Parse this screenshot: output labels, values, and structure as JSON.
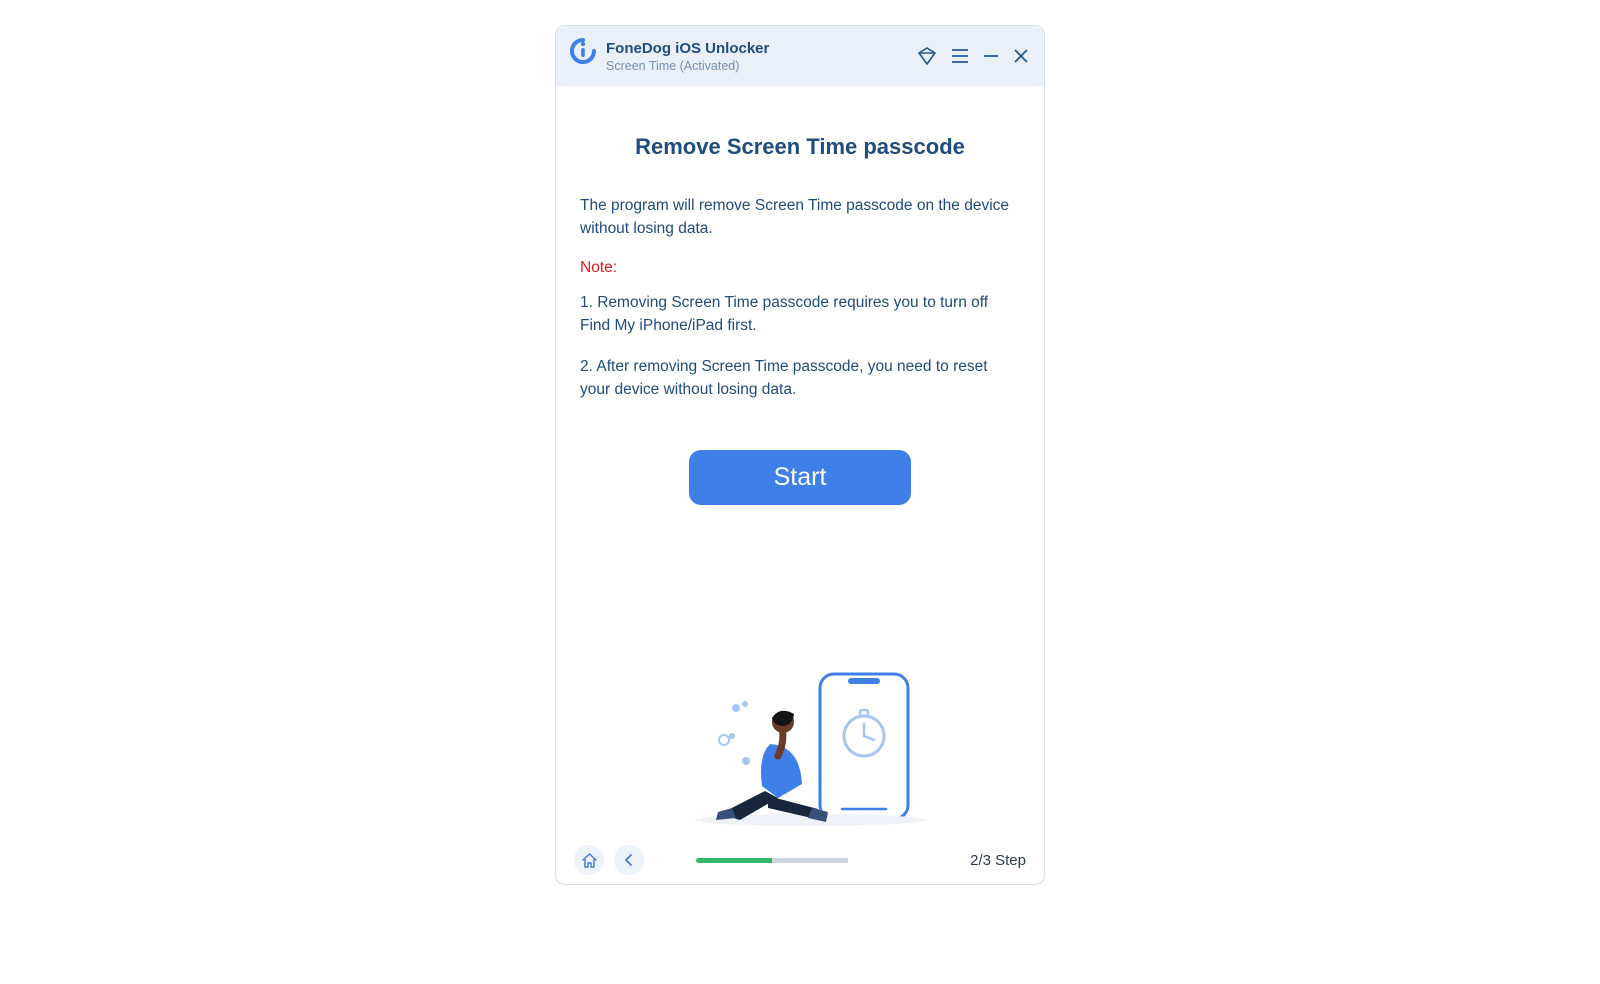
{
  "titlebar": {
    "app_name": "FoneDog iOS Unlocker",
    "subtitle": "Screen Time  (Activated)"
  },
  "content": {
    "heading": "Remove Screen Time passcode",
    "intro": "The program will remove Screen Time passcode on the device without losing data.",
    "note_label": "Note:",
    "note1": "1. Removing Screen Time passcode requires you to turn off Find My iPhone/iPad first.",
    "note2": "2. After removing Screen Time passcode, you need to reset your device without losing data.",
    "start_label": "Start"
  },
  "footer": {
    "step_text": "2/3 Step"
  }
}
